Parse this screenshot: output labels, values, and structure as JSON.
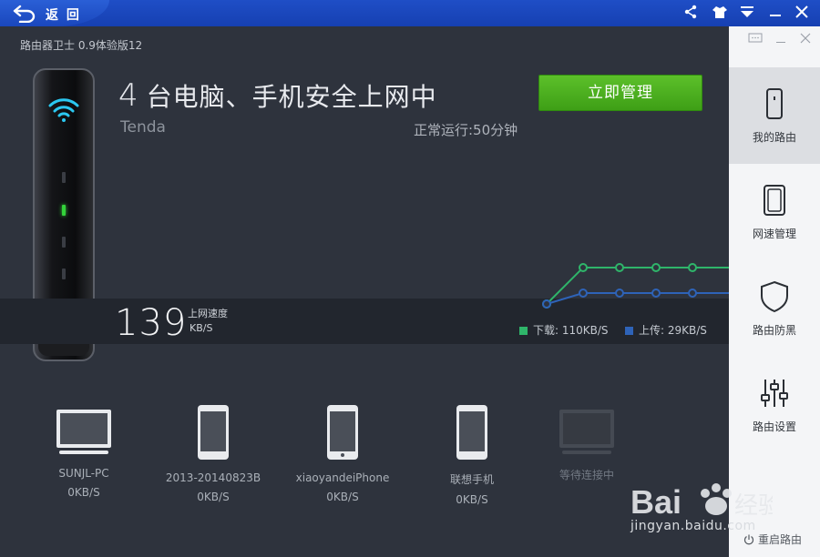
{
  "titlebar": {
    "back_label": "返 回",
    "icons": [
      "share-icon",
      "shirt-icon",
      "menu-icon",
      "minimize-icon",
      "close-icon"
    ]
  },
  "main": {
    "version": "路由器卫士 0.9体验版12",
    "device_count": "4",
    "headline": "台电脑、手机安全上网中",
    "brand": "Tenda",
    "uptime": "正常运行:50分钟",
    "manage_button": "立即管理",
    "speed_value": "139",
    "speed_label": "上网速度",
    "speed_unit": "KB/S",
    "download_legend": "下载: 110KB/S",
    "upload_legend": "上传: 29KB/S",
    "colors": {
      "download": "#2fb56a",
      "upload": "#2e63b8",
      "button": "#4caf22"
    }
  },
  "chart_data": {
    "type": "line",
    "series": [
      {
        "name": "下载: 110KB/S",
        "values": [
          0,
          1,
          1,
          1,
          1
        ]
      },
      {
        "name": "上传: 29KB/S",
        "values": [
          0,
          0.3,
          0.3,
          0.3,
          0.3
        ]
      }
    ]
  },
  "devices": [
    {
      "type": "pc-icon",
      "name": "SUNJL-PC",
      "rate": "0KB/S"
    },
    {
      "type": "phone-icon",
      "name": "2013-20140823B",
      "rate": "0KB/S"
    },
    {
      "type": "phone-icon",
      "name": "xiaoyandeiPhone",
      "rate": "0KB/S"
    },
    {
      "type": "phone-icon",
      "name": "联想手机",
      "rate": "0KB/S"
    },
    {
      "type": "pc-icon",
      "name": "等待连接中",
      "rate": ""
    }
  ],
  "sidebar": {
    "items": [
      {
        "label": "我的路由",
        "icon": "router-icon",
        "active": true
      },
      {
        "label": "网速管理",
        "icon": "speed-icon"
      },
      {
        "label": "路由防黑",
        "icon": "shield-icon"
      },
      {
        "label": "路由设置",
        "icon": "settings-sliders-icon"
      }
    ],
    "restart": "重启路由"
  },
  "watermark": {
    "text": "jingyan.baidu.com",
    "brand": "Baidu 经验"
  }
}
